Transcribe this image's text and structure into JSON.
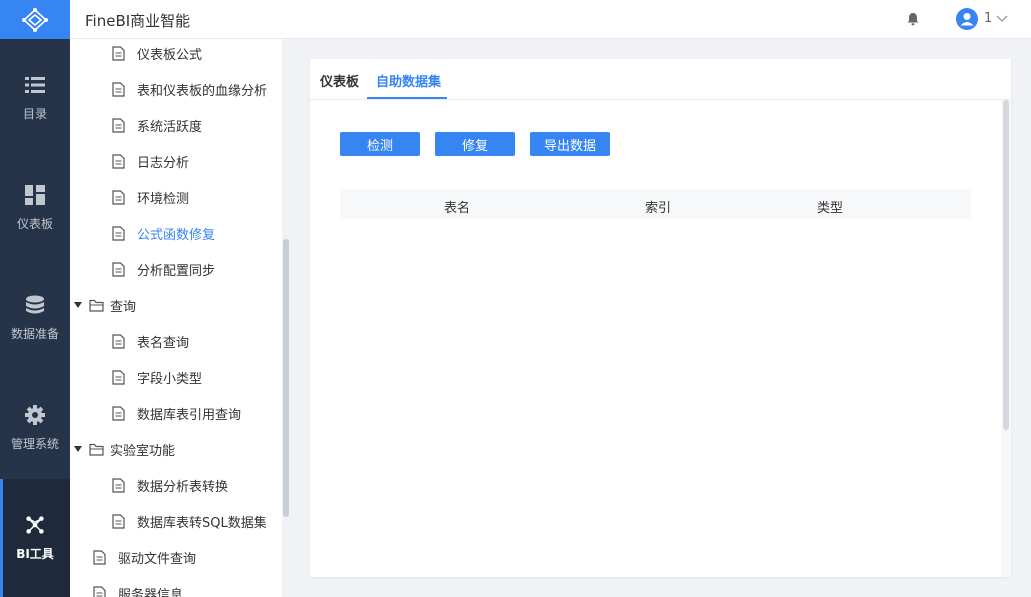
{
  "header": {
    "app_title": "FineBI商业智能",
    "user_name": "1"
  },
  "nav": {
    "items": [
      {
        "label": "目录",
        "icon": "list-icon"
      },
      {
        "label": "仪表板",
        "icon": "dashboard-icon"
      },
      {
        "label": "数据准备",
        "icon": "database-icon"
      },
      {
        "label": "管理系统",
        "icon": "gear-icon"
      },
      {
        "label": "BI工具",
        "icon": "network-icon",
        "active": true
      }
    ]
  },
  "tree": {
    "items": [
      {
        "label": "仪表板公式",
        "type": "file"
      },
      {
        "label": "表和仪表板的血缘分析",
        "type": "file"
      },
      {
        "label": "系统活跃度",
        "type": "file"
      },
      {
        "label": "日志分析",
        "type": "file"
      },
      {
        "label": "环境检测",
        "type": "file"
      },
      {
        "label": "公式函数修复",
        "type": "file",
        "selected": true
      },
      {
        "label": "分析配置同步",
        "type": "file"
      },
      {
        "label": "查询",
        "type": "folder"
      },
      {
        "label": "表名查询",
        "type": "file"
      },
      {
        "label": "字段小类型",
        "type": "file"
      },
      {
        "label": "数据库表引用查询",
        "type": "file"
      },
      {
        "label": "实验室功能",
        "type": "folder"
      },
      {
        "label": "数据分析表转换",
        "type": "file"
      },
      {
        "label": "数据库表转SQL数据集",
        "type": "file"
      },
      {
        "label": "驱动文件查询",
        "type": "file"
      },
      {
        "label": "服务器信息",
        "type": "file"
      }
    ]
  },
  "main": {
    "tabs": [
      {
        "label": "仪表板"
      },
      {
        "label": "自助数据集",
        "active": true
      }
    ],
    "buttons": {
      "detect": "检测",
      "repair": "修复",
      "export": "导出数据"
    },
    "table": {
      "columns": [
        "表名",
        "索引",
        "类型"
      ]
    }
  },
  "colors": {
    "accent": "#3685f2",
    "nav_bg": "#263449"
  }
}
